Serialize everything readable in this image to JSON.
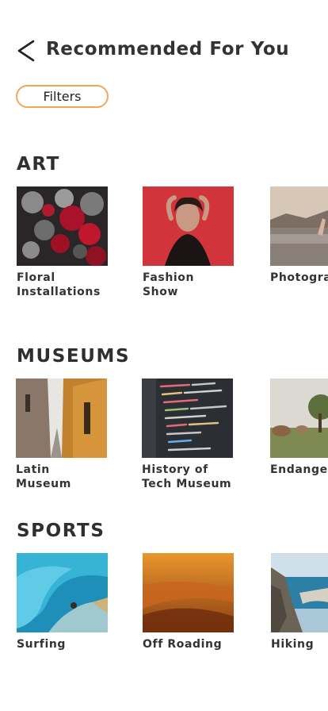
{
  "header": {
    "title": "Recommended For You",
    "back_icon": "chevron-left-icon"
  },
  "filters": {
    "label": "Filters",
    "border_color": "#f2a55b"
  },
  "sections": [
    {
      "title": "ART",
      "items": [
        {
          "label": "Floral\nInstallations"
        },
        {
          "label": "Fashion Show"
        },
        {
          "label": "Photogra"
        }
      ]
    },
    {
      "title": "MUSEUMS",
      "items": [
        {
          "label": "Latin Museum"
        },
        {
          "label": "History of\nTech Museum"
        },
        {
          "label": "Endanger"
        }
      ]
    },
    {
      "title": "SPORTS",
      "items": [
        {
          "label": "Surfing"
        },
        {
          "label": "Off Roading"
        },
        {
          "label": "Hiking"
        }
      ]
    }
  ]
}
